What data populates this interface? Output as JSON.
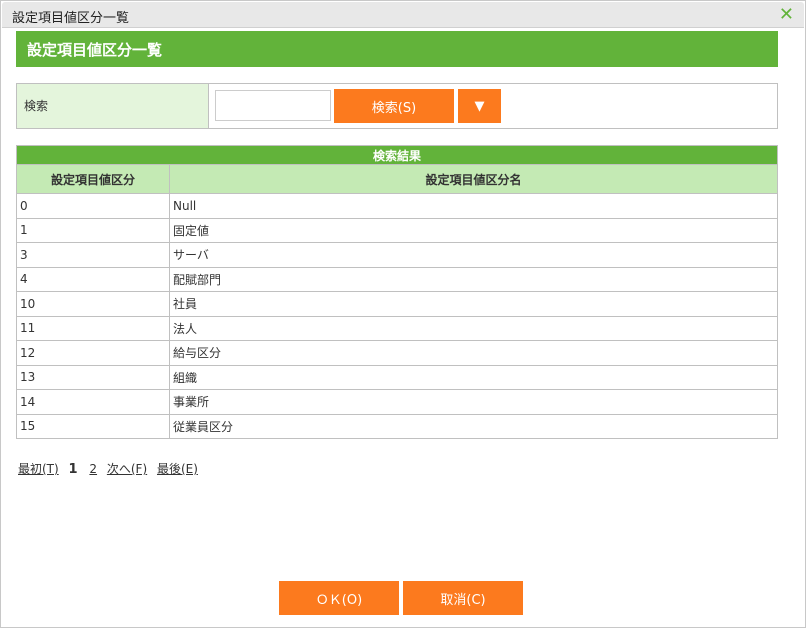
{
  "dialog": {
    "title": "設定項目値区分一覧",
    "close_icon": "×"
  },
  "header": {
    "title": "設定項目値区分一覧"
  },
  "search": {
    "label": "検索",
    "value": "",
    "button": "検索(S)",
    "dropdown": "▼"
  },
  "results": {
    "caption": "検索結果",
    "columns": [
      "設定項目値区分",
      "設定項目値区分名"
    ],
    "rows": [
      [
        "0",
        "Null"
      ],
      [
        "1",
        "固定値"
      ],
      [
        "3",
        "サーバ"
      ],
      [
        "4",
        "配賦部門"
      ],
      [
        "10",
        "社員"
      ],
      [
        "11",
        "法人"
      ],
      [
        "12",
        "給与区分"
      ],
      [
        "13",
        "組織"
      ],
      [
        "14",
        "事業所"
      ],
      [
        "15",
        "従業員区分"
      ]
    ]
  },
  "pager": {
    "first": "最初(T)",
    "current": "1",
    "page2": "2",
    "next": "次へ(F)",
    "last": "最後(E)"
  },
  "footer": {
    "ok": "ＯＫ(O)",
    "cancel": "取消(C)"
  }
}
